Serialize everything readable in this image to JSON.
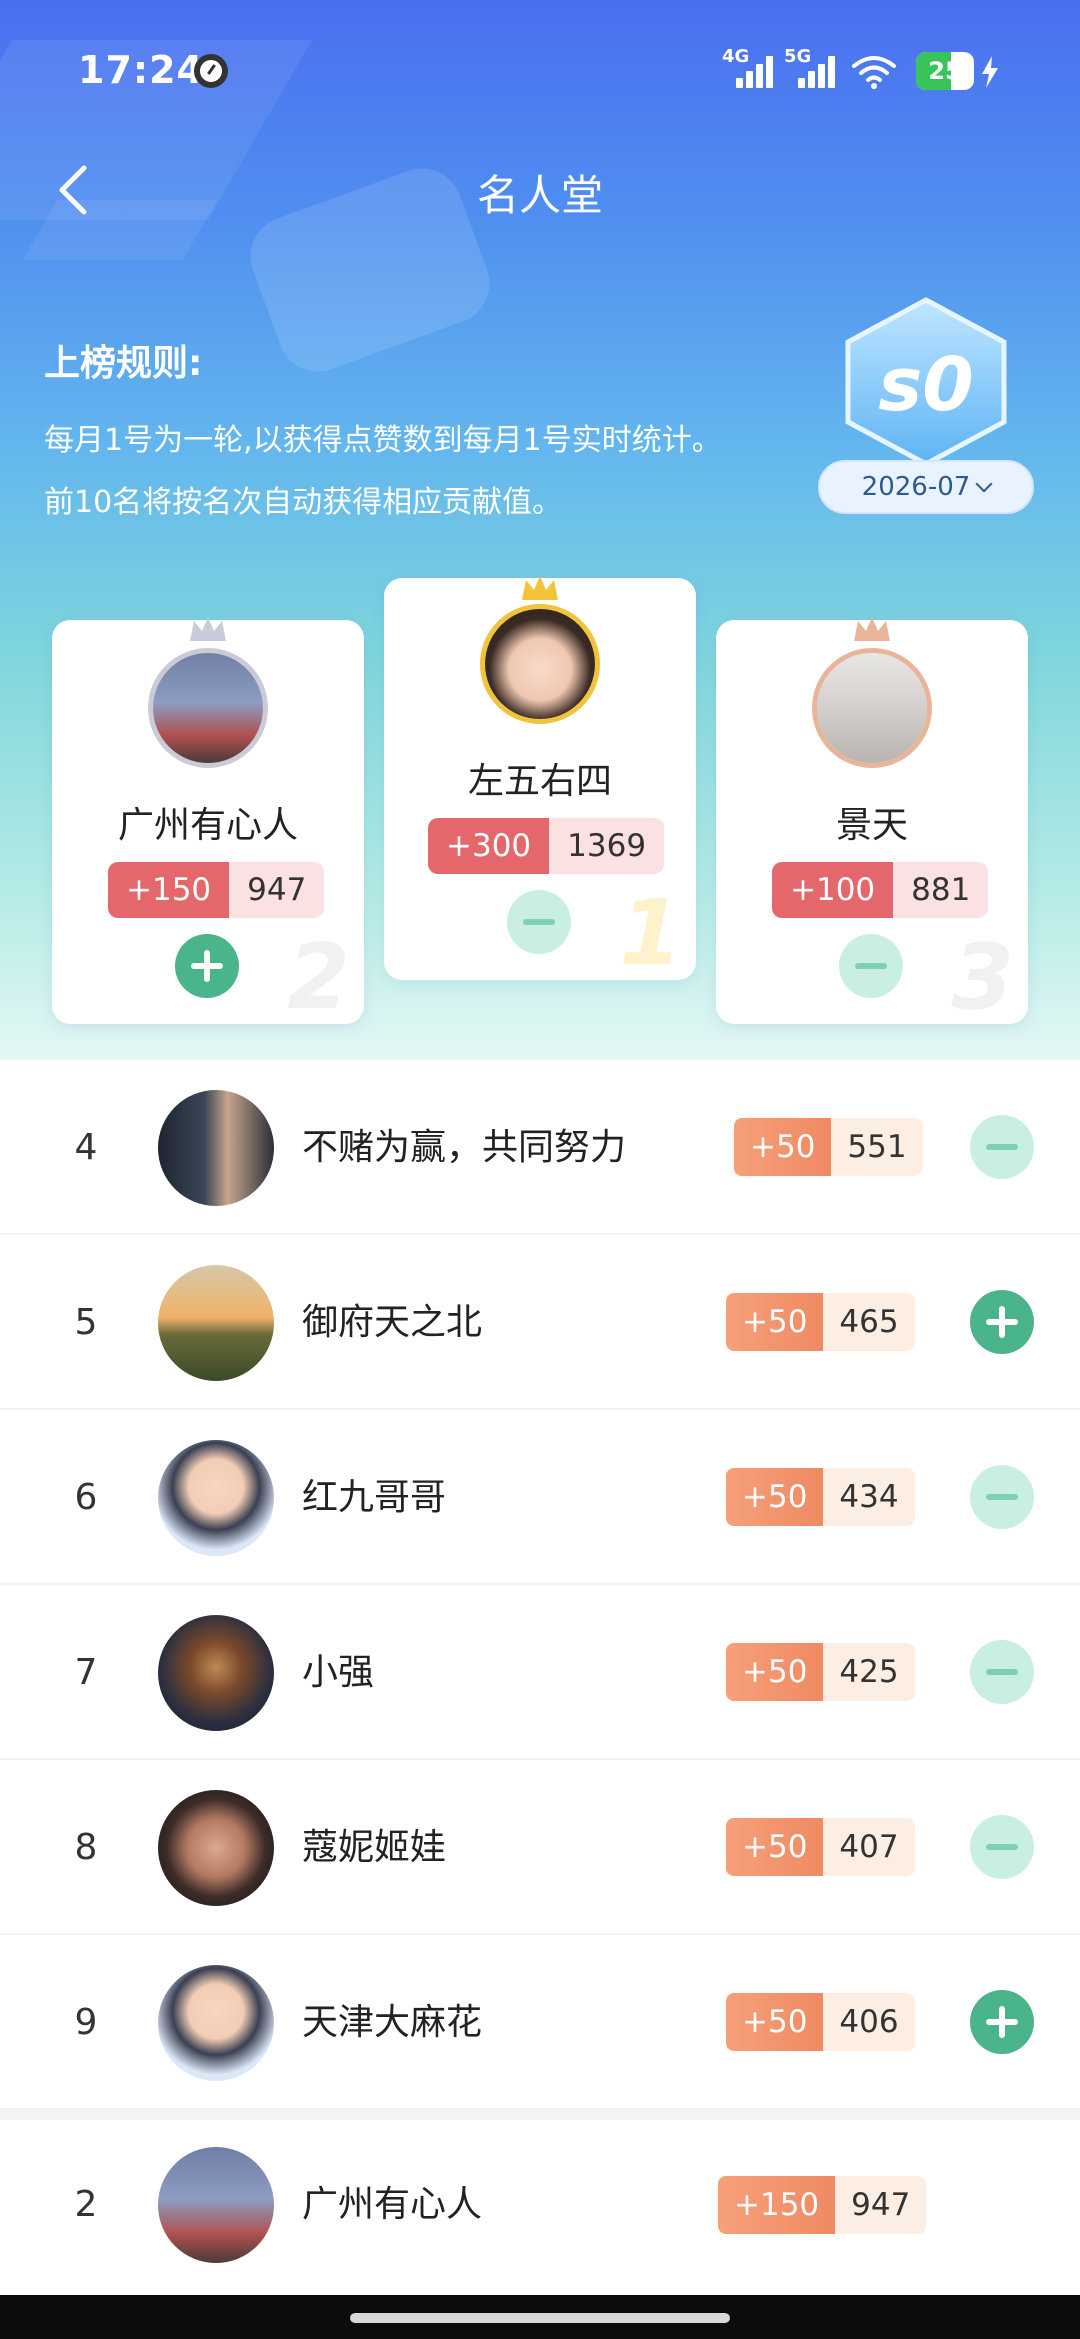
{
  "status": {
    "time": "17:24",
    "net1": "4G",
    "net2": "5G",
    "battery": "25"
  },
  "header": {
    "title": "名人堂"
  },
  "rules": {
    "title": "上榜规则:",
    "text": "每月1号为一轮,以获得点赞数到每月1号实时统计。前10名将按名次自动获得相应贡献值。"
  },
  "season": {
    "badge": "s0",
    "date": "2026-07"
  },
  "podium": [
    {
      "rank": "2",
      "name": "广州有心人",
      "plus": "+150",
      "total": "947",
      "toggle": "add"
    },
    {
      "rank": "1",
      "name": "左五右四",
      "plus": "+300",
      "total": "1369",
      "toggle": "remove"
    },
    {
      "rank": "3",
      "name": "景天",
      "plus": "+100",
      "total": "881",
      "toggle": "remove"
    }
  ],
  "list": [
    {
      "rank": "4",
      "name": "不赌为赢，共同努力",
      "plus": "+50",
      "total": "551",
      "toggle": "remove"
    },
    {
      "rank": "5",
      "name": "御府天之北",
      "plus": "+50",
      "total": "465",
      "toggle": "add"
    },
    {
      "rank": "6",
      "name": "红九哥哥",
      "plus": "+50",
      "total": "434",
      "toggle": "remove"
    },
    {
      "rank": "7",
      "name": "小强",
      "plus": "+50",
      "total": "425",
      "toggle": "remove"
    },
    {
      "rank": "8",
      "name": "蔻妮姬娃",
      "plus": "+50",
      "total": "407",
      "toggle": "remove"
    },
    {
      "rank": "9",
      "name": "天津大麻花",
      "plus": "+50",
      "total": "406",
      "toggle": "add"
    }
  ],
  "my_rank": {
    "rank": "2",
    "name": "广州有心人",
    "plus": "+150",
    "total": "947"
  },
  "colors": {
    "accent_green": "#4ab48a",
    "score_red": "#e4686b",
    "score_orange": "#ef8a63"
  }
}
